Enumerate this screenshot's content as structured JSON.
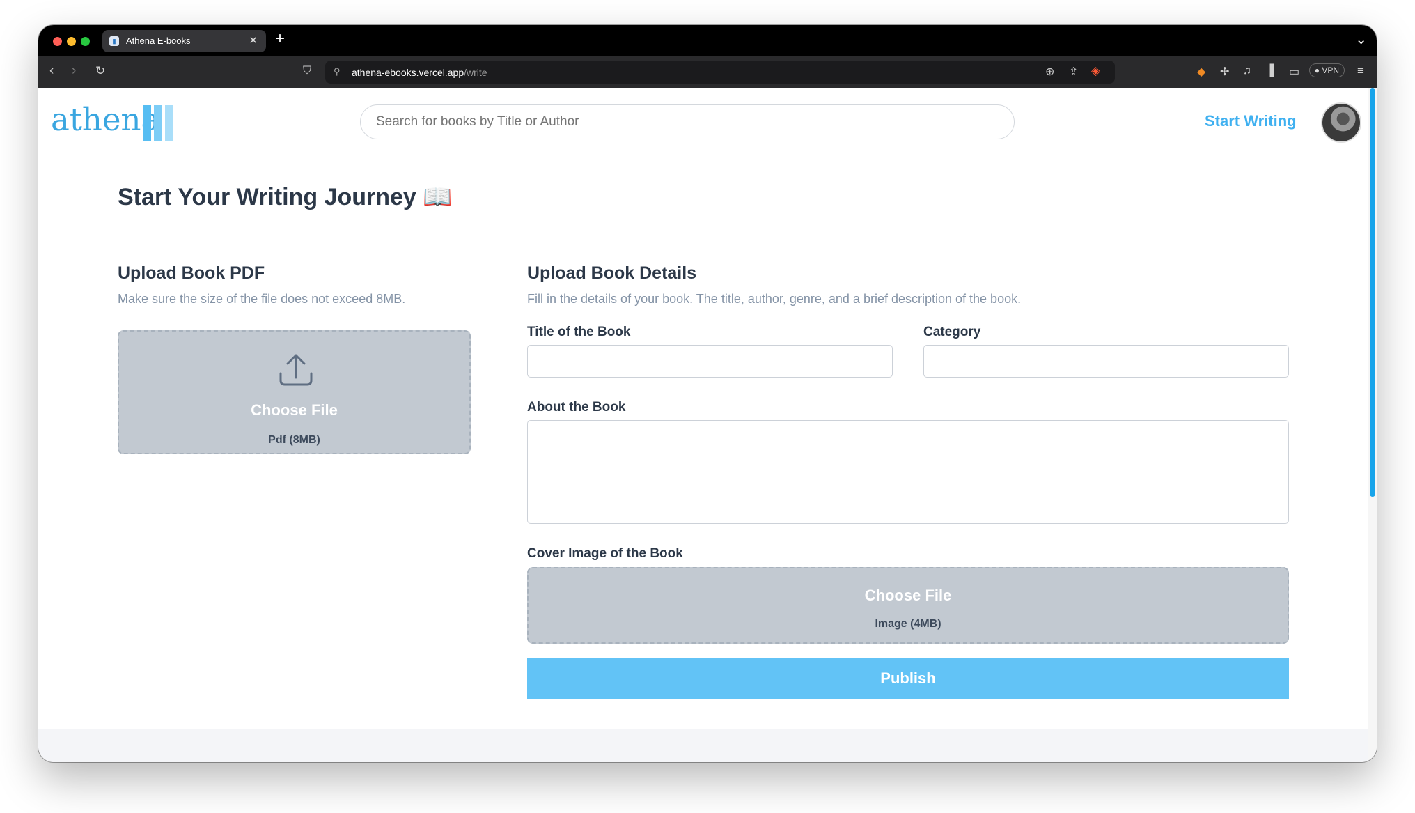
{
  "browser": {
    "tab_title": "Athena E-books",
    "new_tab": "+",
    "url_host": "athena-ebooks.vercel.app",
    "url_path": "/write",
    "vpn_label": "VPN"
  },
  "header": {
    "logo_text": "athena",
    "search_placeholder": "Search for books by Title or Author",
    "start_writing": "Start Writing"
  },
  "page": {
    "title": "Start Your Writing Journey 📖",
    "upload_pdf": {
      "title": "Upload Book PDF",
      "description": "Make sure the size of the file does not exceed 8MB.",
      "choose_label": "Choose File",
      "hint": "Pdf (8MB)"
    },
    "details": {
      "title": "Upload Book Details",
      "description": "Fill in the details of your book. The title, author, genre, and a brief description of the book.",
      "title_label": "Title of the Book",
      "title_value": "",
      "category_label": "Category",
      "category_value": "",
      "about_label": "About the Book",
      "about_value": "",
      "cover_label": "Cover Image of the Book",
      "cover_choose": "Choose File",
      "cover_hint": "Image (4MB)"
    },
    "publish_label": "Publish"
  },
  "icons": [
    "back-icon",
    "forward-icon",
    "reload-icon",
    "bookmark-icon",
    "site-info-icon",
    "zoom-icon",
    "share-icon",
    "brave-shield-icon",
    "extension-icon",
    "music-icon",
    "sidebar-icon",
    "wallet-icon",
    "menu-icon",
    "upload-icon",
    "tab-list-icon"
  ],
  "colors": {
    "accent": "#3fb0f0",
    "publish": "#62c3f6",
    "dropzone": "#c2c9d1",
    "heading": "#2c3848"
  }
}
